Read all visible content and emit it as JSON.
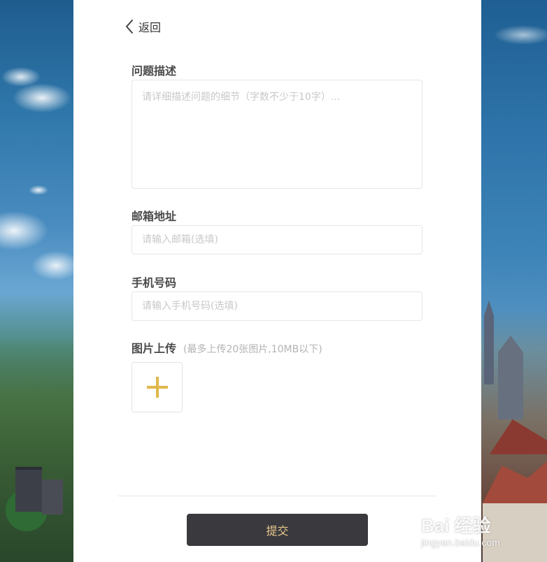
{
  "header": {
    "back_label": "返回"
  },
  "form": {
    "description": {
      "label": "问题描述",
      "placeholder": "请详细描述问题的细节（字数不少于10字）..."
    },
    "email": {
      "label": "邮箱地址",
      "placeholder": "请输入邮箱(选填)"
    },
    "phone": {
      "label": "手机号码",
      "placeholder": "请输入手机号码(选填)"
    },
    "image_upload": {
      "label": "图片上传",
      "hint": "(最多上传20张图片,10MB以下)"
    },
    "submit_label": "提交"
  },
  "watermark": {
    "brand": "Bai 经验",
    "url": "jingyan.baidu.com"
  },
  "colors": {
    "submit_bg": "#3a393e",
    "submit_text": "#e9c98c",
    "plus_icon": "#e0b84c"
  },
  "icons": {
    "back": "chevron-left-icon",
    "upload": "plus-icon"
  }
}
